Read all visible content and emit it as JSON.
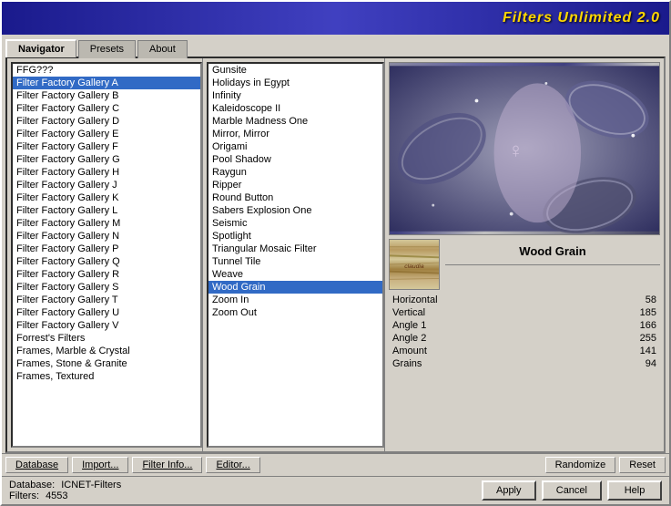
{
  "app": {
    "title": "Filters Unlimited 2.0"
  },
  "tabs": [
    {
      "label": "Navigator",
      "active": true
    },
    {
      "label": "Presets",
      "active": false
    },
    {
      "label": "About",
      "active": false
    }
  ],
  "categories": [
    {
      "id": "ffg000",
      "label": "FFG???"
    },
    {
      "id": "ffgA",
      "label": "Filter Factory Gallery A"
    },
    {
      "id": "ffgB",
      "label": "Filter Factory Gallery B"
    },
    {
      "id": "ffgC",
      "label": "Filter Factory Gallery C"
    },
    {
      "id": "ffgD",
      "label": "Filter Factory Gallery D"
    },
    {
      "id": "ffgE",
      "label": "Filter Factory Gallery E"
    },
    {
      "id": "ffgF",
      "label": "Filter Factory Gallery F"
    },
    {
      "id": "ffgG",
      "label": "Filter Factory Gallery G"
    },
    {
      "id": "ffgH",
      "label": "Filter Factory Gallery H"
    },
    {
      "id": "ffgJ",
      "label": "Filter Factory Gallery J"
    },
    {
      "id": "ffgK",
      "label": "Filter Factory Gallery K"
    },
    {
      "id": "ffgL",
      "label": "Filter Factory Gallery L"
    },
    {
      "id": "ffgM",
      "label": "Filter Factory Gallery M"
    },
    {
      "id": "ffgN",
      "label": "Filter Factory Gallery N"
    },
    {
      "id": "ffgP",
      "label": "Filter Factory Gallery P"
    },
    {
      "id": "ffgQ",
      "label": "Filter Factory Gallery Q"
    },
    {
      "id": "ffgR",
      "label": "Filter Factory Gallery R"
    },
    {
      "id": "ffgS",
      "label": "Filter Factory Gallery S"
    },
    {
      "id": "ffgT",
      "label": "Filter Factory Gallery T"
    },
    {
      "id": "ffgU",
      "label": "Filter Factory Gallery U"
    },
    {
      "id": "ffgV",
      "label": "Filter Factory Gallery V"
    },
    {
      "id": "forrest",
      "label": "Forrest's Filters"
    },
    {
      "id": "framesmarble",
      "label": "Frames, Marble & Crystal"
    },
    {
      "id": "framesstone",
      "label": "Frames, Stone & Granite"
    },
    {
      "id": "framestextured",
      "label": "Frames, Textured"
    }
  ],
  "filters": [
    {
      "id": "gunsite",
      "label": "Gunsite"
    },
    {
      "id": "holidays",
      "label": "Holidays in Egypt"
    },
    {
      "id": "infinity",
      "label": "Infinity"
    },
    {
      "id": "kaleidoscope",
      "label": "Kaleidoscope II"
    },
    {
      "id": "marblemadness",
      "label": "Marble Madness One"
    },
    {
      "id": "mirrormirror",
      "label": "Mirror, Mirror"
    },
    {
      "id": "origami",
      "label": "Origami"
    },
    {
      "id": "poolshadow",
      "label": "Pool Shadow"
    },
    {
      "id": "raygun",
      "label": "Raygun"
    },
    {
      "id": "ripper",
      "label": "Ripper"
    },
    {
      "id": "roundbutton",
      "label": "Round Button"
    },
    {
      "id": "sabersexplosion",
      "label": "Sabers Explosion One"
    },
    {
      "id": "seismic",
      "label": "Seismic"
    },
    {
      "id": "spotlight",
      "label": "Spotlight"
    },
    {
      "id": "triangularmosaic",
      "label": "Triangular Mosaic Filter"
    },
    {
      "id": "tunneltile",
      "label": "Tunnel Tile"
    },
    {
      "id": "weave",
      "label": "Weave"
    },
    {
      "id": "woodgrain",
      "label": "Wood Grain",
      "selected": true
    },
    {
      "id": "zoomin",
      "label": "Zoom In"
    },
    {
      "id": "zoomout",
      "label": "Zoom Out"
    }
  ],
  "selected_filter": {
    "name": "Wood Grain",
    "thumbnail_text": "claudia",
    "params": [
      {
        "label": "Horizontal",
        "value": "58"
      },
      {
        "label": "Vertical",
        "value": "185"
      },
      {
        "label": "Angle 1",
        "value": "166"
      },
      {
        "label": "Angle 2",
        "value": "255"
      },
      {
        "label": "Amount",
        "value": "141"
      },
      {
        "label": "Grains",
        "value": "94"
      }
    ]
  },
  "toolbar": {
    "database_label": "Database",
    "import_label": "Import...",
    "filterinfo_label": "Filter Info...",
    "editor_label": "Editor...",
    "randomize_label": "Randomize",
    "reset_label": "Reset"
  },
  "statusbar": {
    "database_label": "Database:",
    "database_value": "ICNET-Filters",
    "filters_label": "Filters:",
    "filters_count": "4553"
  },
  "actions": {
    "apply_label": "Apply",
    "cancel_label": "Cancel",
    "help_label": "Help"
  }
}
